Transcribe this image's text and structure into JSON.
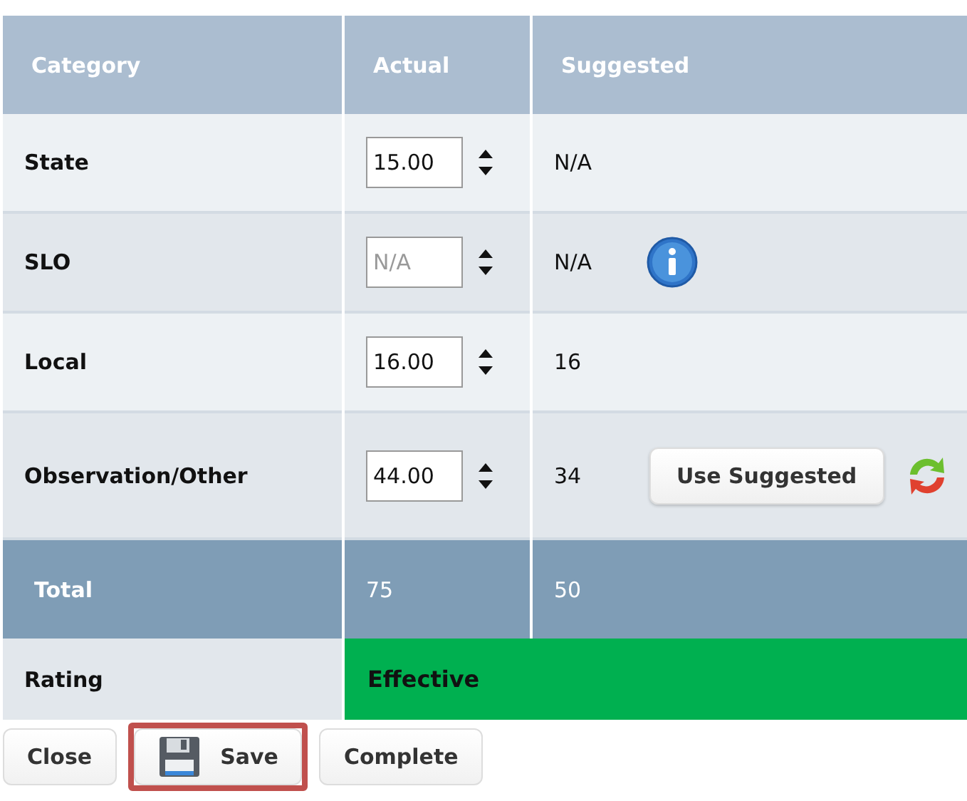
{
  "table": {
    "columns": [
      "Category",
      "Actual",
      "Suggested"
    ],
    "rows": [
      {
        "category": "State",
        "actual": {
          "value": "15.00"
        },
        "suggested": "N/A"
      },
      {
        "category": "SLO",
        "actual": {
          "placeholder": "N/A"
        },
        "suggested": "N/A",
        "info": true
      },
      {
        "category": "Local",
        "actual": {
          "value": "16.00"
        },
        "suggested": "16"
      },
      {
        "category": "Observation/Other",
        "actual": {
          "value": "44.00"
        },
        "suggested": "34",
        "action": "Use Suggested",
        "refresh": true
      }
    ],
    "total": {
      "label": "Total",
      "actual": "75",
      "suggested": "50"
    },
    "rating": {
      "label": "Rating",
      "value": "Effective",
      "color": "#00b050"
    }
  },
  "buttons": [
    {
      "label": "Close",
      "kind": "plain",
      "highlighted": false
    },
    {
      "label": "Save",
      "kind": "save",
      "highlighted": true
    },
    {
      "label": "Complete",
      "kind": "plain",
      "highlighted": false
    }
  ]
}
